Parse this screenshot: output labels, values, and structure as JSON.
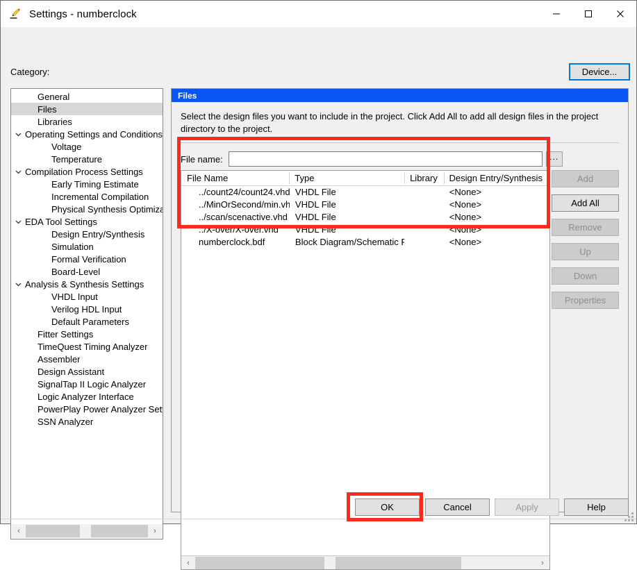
{
  "window": {
    "title": "Settings - numberclock",
    "icon": "pencil-settings-icon",
    "minimize_label": "–",
    "maximize_label": "☐",
    "close_label": "✕"
  },
  "category": {
    "label": "Category:",
    "device_button": "Device...",
    "items": [
      {
        "label": "General",
        "indent": 1,
        "chevron": "",
        "selected": false
      },
      {
        "label": "Files",
        "indent": 1,
        "chevron": "",
        "selected": true
      },
      {
        "label": "Libraries",
        "indent": 1,
        "chevron": "",
        "selected": false
      },
      {
        "label": "Operating Settings and Conditions",
        "indent": 0,
        "chevron": "⌄",
        "selected": false
      },
      {
        "label": "Voltage",
        "indent": 2,
        "chevron": "",
        "selected": false
      },
      {
        "label": "Temperature",
        "indent": 2,
        "chevron": "",
        "selected": false
      },
      {
        "label": "Compilation Process Settings",
        "indent": 0,
        "chevron": "⌄",
        "selected": false
      },
      {
        "label": "Early Timing Estimate",
        "indent": 2,
        "chevron": "",
        "selected": false
      },
      {
        "label": "Incremental Compilation",
        "indent": 2,
        "chevron": "",
        "selected": false
      },
      {
        "label": "Physical Synthesis Optimization",
        "indent": 2,
        "chevron": "",
        "selected": false
      },
      {
        "label": "EDA Tool Settings",
        "indent": 0,
        "chevron": "⌄",
        "selected": false
      },
      {
        "label": "Design Entry/Synthesis",
        "indent": 2,
        "chevron": "",
        "selected": false
      },
      {
        "label": "Simulation",
        "indent": 2,
        "chevron": "",
        "selected": false
      },
      {
        "label": "Formal Verification",
        "indent": 2,
        "chevron": "",
        "selected": false
      },
      {
        "label": "Board-Level",
        "indent": 2,
        "chevron": "",
        "selected": false
      },
      {
        "label": "Analysis & Synthesis Settings",
        "indent": 0,
        "chevron": "⌄",
        "selected": false
      },
      {
        "label": "VHDL Input",
        "indent": 2,
        "chevron": "",
        "selected": false
      },
      {
        "label": "Verilog HDL Input",
        "indent": 2,
        "chevron": "",
        "selected": false
      },
      {
        "label": "Default Parameters",
        "indent": 2,
        "chevron": "",
        "selected": false
      },
      {
        "label": "Fitter Settings",
        "indent": 1,
        "chevron": "",
        "selected": false
      },
      {
        "label": "TimeQuest Timing Analyzer",
        "indent": 1,
        "chevron": "",
        "selected": false
      },
      {
        "label": "Assembler",
        "indent": 1,
        "chevron": "",
        "selected": false
      },
      {
        "label": "Design Assistant",
        "indent": 1,
        "chevron": "",
        "selected": false
      },
      {
        "label": "SignalTap II Logic Analyzer",
        "indent": 1,
        "chevron": "",
        "selected": false
      },
      {
        "label": "Logic Analyzer Interface",
        "indent": 1,
        "chevron": "",
        "selected": false
      },
      {
        "label": "PowerPlay Power Analyzer Settings",
        "indent": 1,
        "chevron": "",
        "selected": false
      },
      {
        "label": "SSN Analyzer",
        "indent": 1,
        "chevron": "",
        "selected": false
      }
    ]
  },
  "panel": {
    "header": "Files",
    "description": "Select the design files you want to include in the project. Click Add All to add all design files in the project directory to the project.",
    "file_name_label": "File name:",
    "file_name_value": "",
    "file_name_placeholder": "",
    "browse_label": "...",
    "table": {
      "columns": [
        "File Name",
        "Type",
        "Library",
        "Design Entry/Synthesis"
      ],
      "rows": [
        {
          "name": "../count24/count24.vhd",
          "type": "VHDL File",
          "library": "",
          "design_entry": "<None>"
        },
        {
          "name": "../MinOrSecond/min.vhd",
          "type": "VHDL File",
          "library": "",
          "design_entry": "<None>"
        },
        {
          "name": "../scan/scenactive.vhd",
          "type": "VHDL File",
          "library": "",
          "design_entry": "<None>"
        },
        {
          "name": "../X-over/X-over.vhd",
          "type": "VHDL File",
          "library": "",
          "design_entry": "<None>"
        },
        {
          "name": "numberclock.bdf",
          "type": "Block Diagram/Schematic File",
          "library": "",
          "design_entry": "<None>"
        }
      ]
    },
    "side_buttons": [
      {
        "label": "Add",
        "enabled": false
      },
      {
        "label": "Add All",
        "enabled": true
      },
      {
        "label": "Remove",
        "enabled": false
      },
      {
        "label": "Up",
        "enabled": false
      },
      {
        "label": "Down",
        "enabled": false
      },
      {
        "label": "Properties",
        "enabled": false
      }
    ]
  },
  "footer": {
    "ok": "OK",
    "cancel": "Cancel",
    "apply": "Apply",
    "help": "Help"
  },
  "scroll": {
    "left_arrow": "‹",
    "right_arrow": "›"
  },
  "colors": {
    "panel_header": "#0a53f5",
    "accent_focus": "#0078d7",
    "annotation": "#fa2a21",
    "selection": "#d7d7d7"
  }
}
